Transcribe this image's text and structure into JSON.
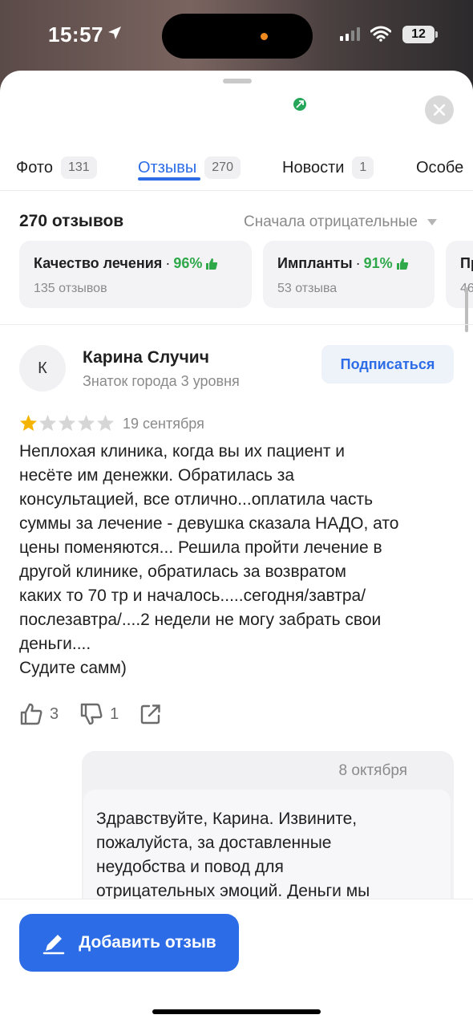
{
  "status_bar": {
    "time": "15:57",
    "battery": "12"
  },
  "tabs": [
    {
      "label": "Фото",
      "count": "131"
    },
    {
      "label": "Отзывы",
      "count": "270"
    },
    {
      "label": "Новости",
      "count": "1"
    },
    {
      "label": "Особе",
      "count": ""
    }
  ],
  "reviews": {
    "count_label": "270 отзывов",
    "sort_label": "Сначала отрицательные",
    "aspects": [
      {
        "title": "Качество лечения",
        "percent": "96%",
        "sub": "135 отзывов"
      },
      {
        "title": "Импланты",
        "percent": "91%",
        "sub": "53 отзыва"
      },
      {
        "title": "Пр",
        "percent": "",
        "sub": "46"
      }
    ]
  },
  "review": {
    "avatar_letter": "К",
    "author": "Карина Случич",
    "level": "Знаток города 3 уровня",
    "subscribe_label": "Подписаться",
    "rating": 1,
    "rating_max": 5,
    "date": "19 сентября",
    "text": "Неплохая клиника, когда вы их пациент и\nнесёте им денежки. Обратилась за\nконсультацией, все отлично...оплатила часть\nсуммы за лечение - девушка сказала НАДО, ато\nцены поменяются... Решила пройти лечение в\nдругой клинике, обратилась за возвратом\nкаких то 70 тр и началось.....сегодня/завтра/\nпослезавтра/....2 недели не могу забрать свои\nденьги....\nСудите самм)",
    "likes": "3",
    "dislikes": "1"
  },
  "reply": {
    "date": "8 октября",
    "text": "Здравствуйте, Карина. Извините,\nпожалуйста, за доставленные\nнеудобства и повод для\nотрицательных эмоций. Деньги мы"
  },
  "add_review_label": "Добавить отзыв",
  "colors": {
    "accent": "#2c6ce6",
    "positive": "#2fa84a",
    "star": "#f5b400",
    "star_empty": "#d6d6d6",
    "verified": "#26a65b"
  },
  "icons": [
    "location-arrow-icon",
    "close-icon",
    "thumbs-up-icon",
    "thumbs-down-icon",
    "share-icon",
    "pencil-icon",
    "star-icon",
    "verified-icon"
  ]
}
